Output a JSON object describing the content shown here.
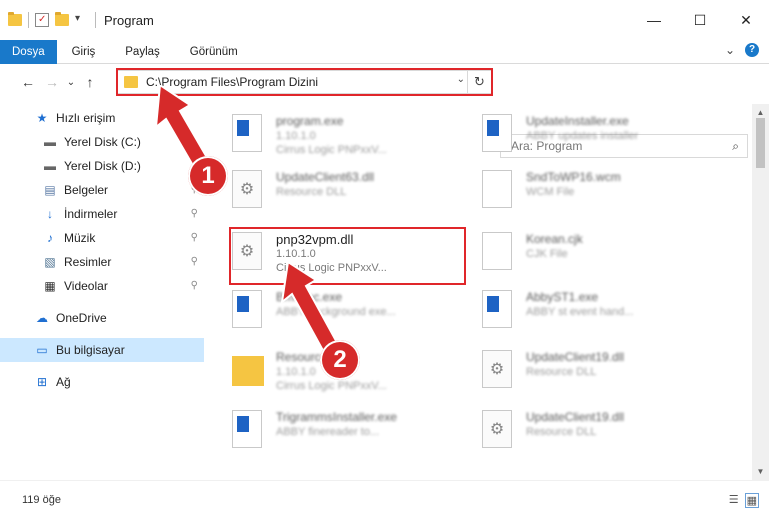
{
  "window": {
    "title": "Program",
    "controls": {
      "minimize": "—",
      "maximize": "☐",
      "close": "✕"
    }
  },
  "ribbon": {
    "tabs": [
      "Dosya",
      "Giriş",
      "Paylaş",
      "Görünüm"
    ],
    "expand": "⌄",
    "help": "?"
  },
  "nav": {
    "back": "←",
    "forward": "→",
    "recent": "⌄",
    "up": "↑",
    "address": "C:\\Program Files\\Program Dizini",
    "address_dropdown": "⌄",
    "refresh": "↻",
    "search_placeholder": "Ara: Program",
    "search_icon": "⌕"
  },
  "sidebar": {
    "items": [
      {
        "label": "Hızlı erişim",
        "icon": "star-icon",
        "glyph": "★",
        "color": "#1f6fd1"
      },
      {
        "label": "Yerel Disk (C:)",
        "icon": "drive-icon",
        "glyph": "▬",
        "color": "#666666"
      },
      {
        "label": "Yerel Disk (D:)",
        "icon": "drive-icon",
        "glyph": "▬",
        "color": "#666666"
      },
      {
        "label": "Belgeler",
        "icon": "documents-icon",
        "glyph": "▤",
        "color": "#5a7aa5"
      },
      {
        "label": "İndirmeler",
        "icon": "downloads-icon",
        "glyph": "↓",
        "color": "#1f6fd1"
      },
      {
        "label": "Müzik",
        "icon": "music-icon",
        "glyph": "♪",
        "color": "#1f6fd1"
      },
      {
        "label": "Resimler",
        "icon": "pictures-icon",
        "glyph": "▧",
        "color": "#4a6f8f"
      },
      {
        "label": "Videolar",
        "icon": "videos-icon",
        "glyph": "▦",
        "color": "#333333"
      },
      {
        "label": "OneDrive",
        "icon": "cloud-icon",
        "glyph": "☁",
        "color": "#1f6fd1"
      },
      {
        "label": "Bu bilgisayar",
        "icon": "computer-icon",
        "glyph": "▭",
        "color": "#1f6fd1"
      },
      {
        "label": "Ağ",
        "icon": "network-icon",
        "glyph": "⊞",
        "color": "#1f6fd1"
      }
    ],
    "pin_glyph": "⚲"
  },
  "files": [
    {
      "name": "program.exe",
      "sub1": "1.10.1.0",
      "sub2": "Cirrus Logic PNPxxV...",
      "icon": "exe-icon"
    },
    {
      "name": "UpdateInstaller.exe",
      "sub1": "ABBY updates installer",
      "sub2": "",
      "icon": "exe-icon"
    },
    {
      "name": "UpdateClient63.dll",
      "sub1": "Resource DLL",
      "sub2": "",
      "icon": "dll-icon"
    },
    {
      "name": "SndToWP16.wcm",
      "sub1": "WCM File",
      "sub2": "",
      "icon": "file-icon"
    },
    {
      "name": "pnp32vpm.dll",
      "sub1": "1.10.1.0",
      "sub2": "Cirrus Logic PNPxxV...",
      "icon": "gear-icon"
    },
    {
      "name": "Korean.cjk",
      "sub1": "CJK File",
      "sub2": "",
      "icon": "file-icon"
    },
    {
      "name": "Bmexec.exe",
      "sub1": "ABBY background exe...",
      "sub2": "",
      "icon": "exe-icon"
    },
    {
      "name": "AbbyST1.exe",
      "sub1": "ABBY st event hand...",
      "sub2": "",
      "icon": "exe-icon"
    },
    {
      "name": "Resource",
      "sub1": "1.10.1.0",
      "sub2": "Cirrus Logic PNPxxV...",
      "icon": "folder-icon"
    },
    {
      "name": "UpdateClient19.dll",
      "sub1": "Resource DLL",
      "sub2": "",
      "icon": "dll-icon"
    },
    {
      "name": "TrigrammsInstaller.exe",
      "sub1": "ABBY finereader to...",
      "sub2": "",
      "icon": "exe-icon"
    },
    {
      "name": "UpdateClient19.dll",
      "sub1": "Resource DLL",
      "sub2": "",
      "icon": "dll-icon"
    }
  ],
  "status": {
    "count": "119 öğe"
  },
  "view_icons": {
    "details": "☰",
    "tiles": "▦"
  },
  "annotations": {
    "step1": "1",
    "step2": "2",
    "color": "#d62a2a"
  }
}
